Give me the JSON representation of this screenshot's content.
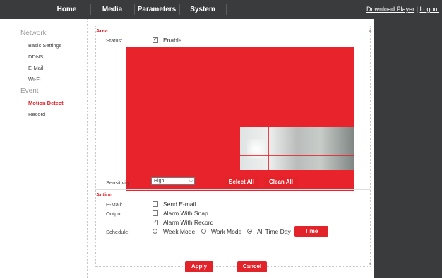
{
  "topnav": {
    "tabs": [
      {
        "label": "Home"
      },
      {
        "label": "Media"
      },
      {
        "label": "Parameters"
      },
      {
        "label": "System"
      }
    ],
    "download_label": "Download Player",
    "separator": "|",
    "logout_label": "Logout"
  },
  "sidebar": {
    "network_heading": "Network",
    "network_items": [
      {
        "label": "Basic Settings"
      },
      {
        "label": "DDNS"
      },
      {
        "label": "E-Mail"
      },
      {
        "label": "Wi-Fi"
      }
    ],
    "event_heading": "Event",
    "event_items": [
      {
        "label": "Motion Detect",
        "active": true
      },
      {
        "label": "Record",
        "active": false
      }
    ]
  },
  "area": {
    "section_label": "Area:",
    "status_label": "Status:",
    "enable_label": "Enable",
    "enable_checked": true,
    "area_color": "#e8232c",
    "sensitivity_label": "Sensitivity:",
    "sensitivity_value": "High",
    "select_all_label": "Select All",
    "clean_all_label": "Clean All"
  },
  "action": {
    "section_label": "Action:",
    "email_label": "E-Mail:",
    "send_email_label": "Send E-mail",
    "send_email_checked": false,
    "output_label": "Output:",
    "alarm_snap_label": "Alarm With Snap",
    "alarm_snap_checked": false,
    "alarm_record_label": "Alarm With Record",
    "alarm_record_checked": true,
    "schedule_label": "Schedule:",
    "week_mode_label": "Week Mode",
    "work_mode_label": "Work Mode",
    "all_time_label": "All Time Day",
    "schedule_selected": "All Time Day",
    "time_button_label": "Time"
  },
  "footer": {
    "apply_label": "Apply",
    "cancel_label": "Cancel"
  },
  "colors": {
    "accent": "#e2232a",
    "topbar": "#3a3b3d"
  }
}
